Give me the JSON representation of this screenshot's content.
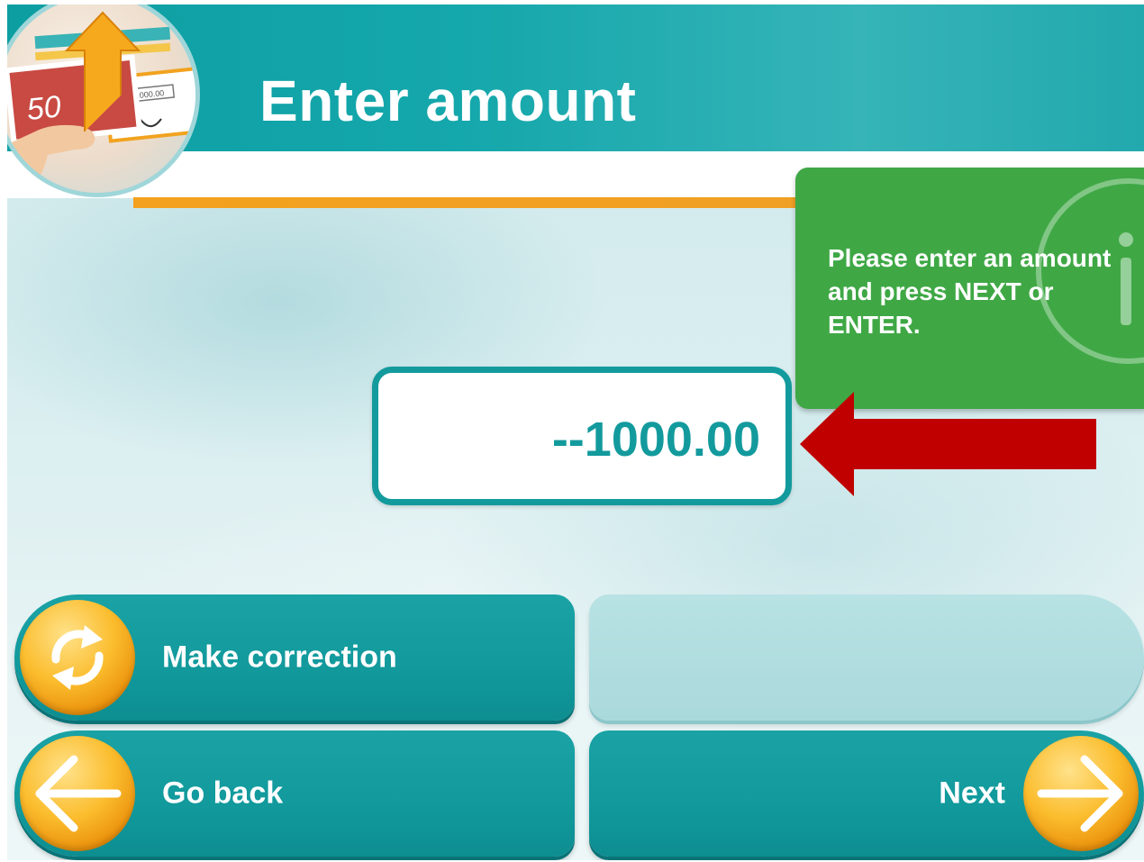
{
  "header": {
    "title": "Enter amount"
  },
  "logo": {
    "note_value": "50",
    "cheque_amount": "1000.00"
  },
  "info": {
    "message": "Please enter an amount and press NEXT or ENTER."
  },
  "amount": {
    "value": "--1000.00"
  },
  "buttons": {
    "correction": "Make correction",
    "back": "Go back",
    "next": "Next"
  },
  "colors": {
    "teal": "#139a9d",
    "info_green": "#3fa845",
    "accent_orange": "#f3a11e",
    "arrow_red": "#c00000"
  }
}
